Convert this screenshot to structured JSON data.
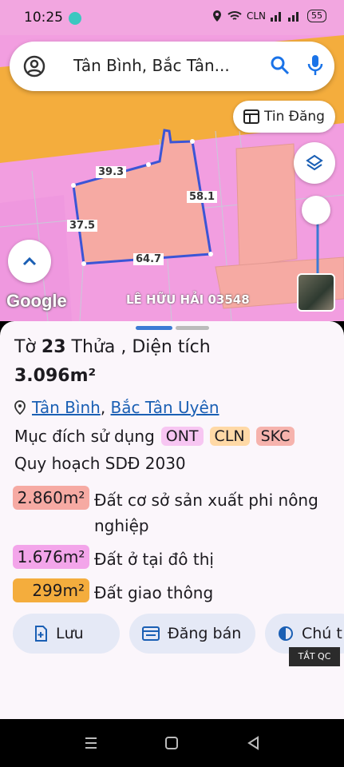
{
  "status_bar": {
    "time": "10:25",
    "carrier": "CLN",
    "battery": "55"
  },
  "search": {
    "text": "Tân Bình, Bắc Tân..."
  },
  "map": {
    "tin_dang_label": "Tin Đăng",
    "dimensions": [
      "39.3",
      "58.1",
      "37.5",
      "64.7"
    ],
    "google_label": "Google",
    "watermark": "LÊ HỮU HẢI 03548"
  },
  "parcel": {
    "title_prefix": "Tờ",
    "sheet_no": "23",
    "plot_label": "Thửa",
    "plot_no": "",
    "area_label": ", Diện tích",
    "area": "3.096m²",
    "ward": "Tân Bình",
    "sep": ",",
    "district": "Bắc Tân Uyên",
    "purpose_label": "Mục đích sử dụng",
    "purposes": [
      "ONT",
      "CLN",
      "SKC"
    ],
    "plan_label": "Quy hoạch SDĐ 2030",
    "zones": [
      {
        "area": "2.860m²",
        "desc": "Đất cơ sở sản xuất phi nông nghiệp"
      },
      {
        "area": "1.676m²",
        "desc": "Đất ở tại đô thị"
      },
      {
        "area": "299m²",
        "desc": "Đất giao thông"
      }
    ]
  },
  "actions": {
    "save": "Lưu",
    "post": "Đăng bán",
    "note": "Chú t"
  },
  "ad_label": "TẮT QC",
  "colors": {
    "accent": "#1a5fb4",
    "pink": "#f29ee0",
    "orange": "#f4ad3d"
  }
}
